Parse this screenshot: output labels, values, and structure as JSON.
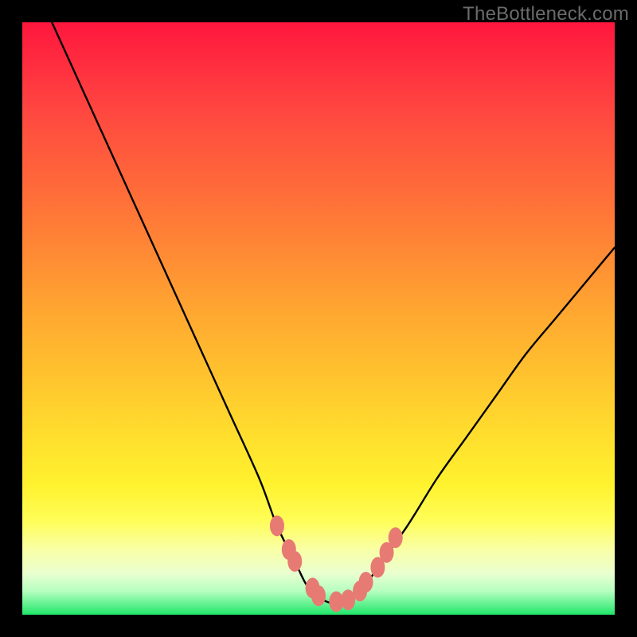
{
  "watermark": "TheBottleneck.com",
  "chart_data": {
    "type": "line",
    "title": "",
    "xlabel": "",
    "ylabel": "",
    "xlim": [
      0,
      100
    ],
    "ylim": [
      0,
      100
    ],
    "series": [
      {
        "name": "bottleneck-curve",
        "x": [
          5,
          10,
          15,
          20,
          25,
          30,
          35,
          40,
          43,
          46,
          48,
          50,
          52,
          54,
          56,
          58,
          60,
          65,
          70,
          75,
          80,
          85,
          90,
          95,
          100
        ],
        "y": [
          100,
          89,
          78,
          67,
          56,
          45,
          34,
          23,
          15,
          9,
          5,
          3,
          2,
          2,
          3,
          5,
          8,
          15,
          23,
          30,
          37,
          44,
          50,
          56,
          62
        ]
      }
    ],
    "markers": {
      "name": "highlight-nodes",
      "color": "#e77b74",
      "points": [
        {
          "x": 43,
          "y": 15
        },
        {
          "x": 45,
          "y": 11
        },
        {
          "x": 46,
          "y": 9
        },
        {
          "x": 49,
          "y": 4.5
        },
        {
          "x": 50,
          "y": 3.2
        },
        {
          "x": 53,
          "y": 2.2
        },
        {
          "x": 55,
          "y": 2.5
        },
        {
          "x": 57,
          "y": 4
        },
        {
          "x": 58,
          "y": 5.5
        },
        {
          "x": 60,
          "y": 8
        },
        {
          "x": 61.5,
          "y": 10.5
        },
        {
          "x": 63,
          "y": 13
        }
      ]
    },
    "background_gradient": {
      "top": "#ff163d",
      "mid_high": "#ff8d34",
      "mid": "#ffdf2d",
      "mid_low": "#f9ffa6",
      "bottom": "#20e66a"
    }
  }
}
